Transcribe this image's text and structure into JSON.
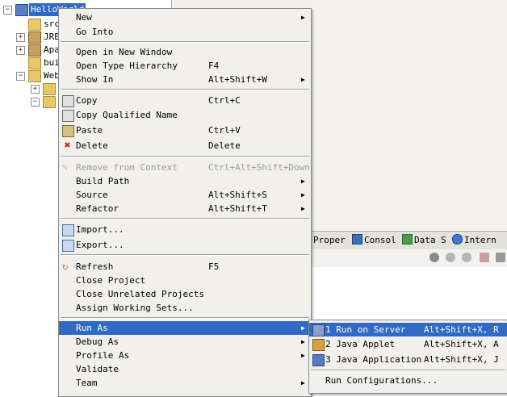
{
  "tree": {
    "project": "HelloWorld",
    "items": [
      {
        "label": "src"
      },
      {
        "label": "JRE"
      },
      {
        "label": "Apa"
      },
      {
        "label": "bui"
      },
      {
        "label": "Web"
      }
    ]
  },
  "views": {
    "tabs": [
      {
        "label": "Proper",
        "icon": "properties-icon"
      },
      {
        "label": "Consol",
        "icon": "console-icon"
      },
      {
        "label": "Data S",
        "icon": "data-source-icon"
      },
      {
        "label": "Intern",
        "icon": "globe-icon"
      }
    ]
  },
  "menu": {
    "items": [
      {
        "label": "New",
        "shortcut": "",
        "submenu": true
      },
      {
        "label": "Go Into",
        "shortcut": ""
      },
      {
        "label": "Open in New Window",
        "shortcut": ""
      },
      {
        "label": "Open Type Hierarchy",
        "shortcut": "F4"
      },
      {
        "label": "Show In",
        "shortcut": "Alt+Shift+W",
        "submenu": true
      },
      {
        "label": "Copy",
        "shortcut": "Ctrl+C",
        "icon": "copy-icon"
      },
      {
        "label": "Copy Qualified Name",
        "shortcut": "",
        "icon": "copy-qualified-name-icon"
      },
      {
        "label": "Paste",
        "shortcut": "Ctrl+V",
        "icon": "paste-icon"
      },
      {
        "label": "Delete",
        "shortcut": "Delete",
        "icon": "delete-icon"
      },
      {
        "label": "Remove from Context",
        "shortcut": "Ctrl+Alt+Shift+Down",
        "disabled": true,
        "icon": "remove-context-icon"
      },
      {
        "label": "Build Path",
        "shortcut": "",
        "submenu": true
      },
      {
        "label": "Source",
        "shortcut": "Alt+Shift+S",
        "submenu": true
      },
      {
        "label": "Refactor",
        "shortcut": "Alt+Shift+T",
        "submenu": true
      },
      {
        "label": "Import...",
        "shortcut": "",
        "icon": "import-icon"
      },
      {
        "label": "Export...",
        "shortcut": "",
        "icon": "export-icon"
      },
      {
        "label": "Refresh",
        "shortcut": "F5",
        "icon": "refresh-icon"
      },
      {
        "label": "Close Project",
        "shortcut": ""
      },
      {
        "label": "Close Unrelated Projects",
        "shortcut": ""
      },
      {
        "label": "Assign Working Sets...",
        "shortcut": ""
      },
      {
        "label": "Run As",
        "shortcut": "",
        "submenu": true,
        "selected": true
      },
      {
        "label": "Debug As",
        "shortcut": "",
        "submenu": true
      },
      {
        "label": "Profile As",
        "shortcut": "",
        "submenu": true
      },
      {
        "label": "Validate",
        "shortcut": ""
      },
      {
        "label": "Team",
        "shortcut": "",
        "submenu": true
      }
    ]
  },
  "run_as": {
    "items": [
      {
        "label": "1 Run on Server",
        "shortcut": "Alt+Shift+X, R",
        "icon": "server-icon",
        "selected": true
      },
      {
        "label": "2 Java Applet",
        "shortcut": "Alt+Shift+X, A",
        "icon": "java-applet-icon"
      },
      {
        "label": "3 Java Application",
        "shortcut": "Alt+Shift+X, J",
        "icon": "java-application-icon"
      },
      {
        "label": "Run Configurations...",
        "shortcut": ""
      }
    ]
  },
  "colors": {
    "selection": "#316ac5",
    "menu_bg": "#f1f0ec"
  }
}
